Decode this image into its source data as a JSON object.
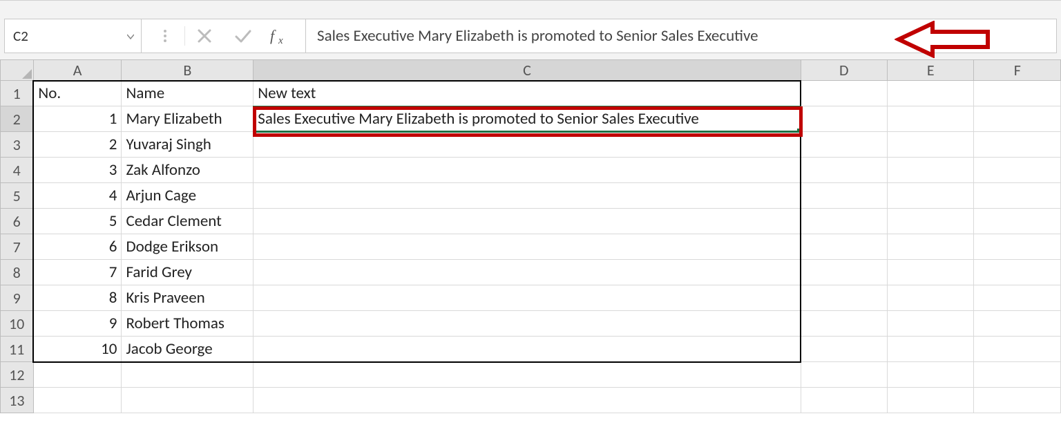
{
  "nameBox": {
    "value": "C2"
  },
  "formulaBar": {
    "value": "Sales Executive Mary Elizabeth is promoted to Senior Sales Executive"
  },
  "columns": [
    "A",
    "B",
    "C",
    "D",
    "E",
    "F"
  ],
  "activeCell": "C2",
  "headers": {
    "A": "No.",
    "B": "Name",
    "C": "New text"
  },
  "rows": [
    {
      "no": "1",
      "name": "Mary Elizabeth",
      "text": " Sales Executive Mary Elizabeth is promoted to Senior Sales Executive"
    },
    {
      "no": "2",
      "name": "Yuvaraj Singh",
      "text": ""
    },
    {
      "no": "3",
      "name": "Zak Alfonzo",
      "text": ""
    },
    {
      "no": "4",
      "name": "Arjun Cage",
      "text": ""
    },
    {
      "no": "5",
      "name": "Cedar Clement",
      "text": ""
    },
    {
      "no": "6",
      "name": "Dodge Erikson",
      "text": ""
    },
    {
      "no": "7",
      "name": "Farid Grey",
      "text": ""
    },
    {
      "no": "8",
      "name": "Kris Praveen",
      "text": ""
    },
    {
      "no": "9",
      "name": "Robert Thomas",
      "text": ""
    },
    {
      "no": "10",
      "name": "Jacob George",
      "text": ""
    }
  ],
  "emptyRows": [
    "12",
    "13"
  ],
  "annotation": {
    "arrowColor": "#c00000",
    "highlightColor": "#c00000"
  }
}
